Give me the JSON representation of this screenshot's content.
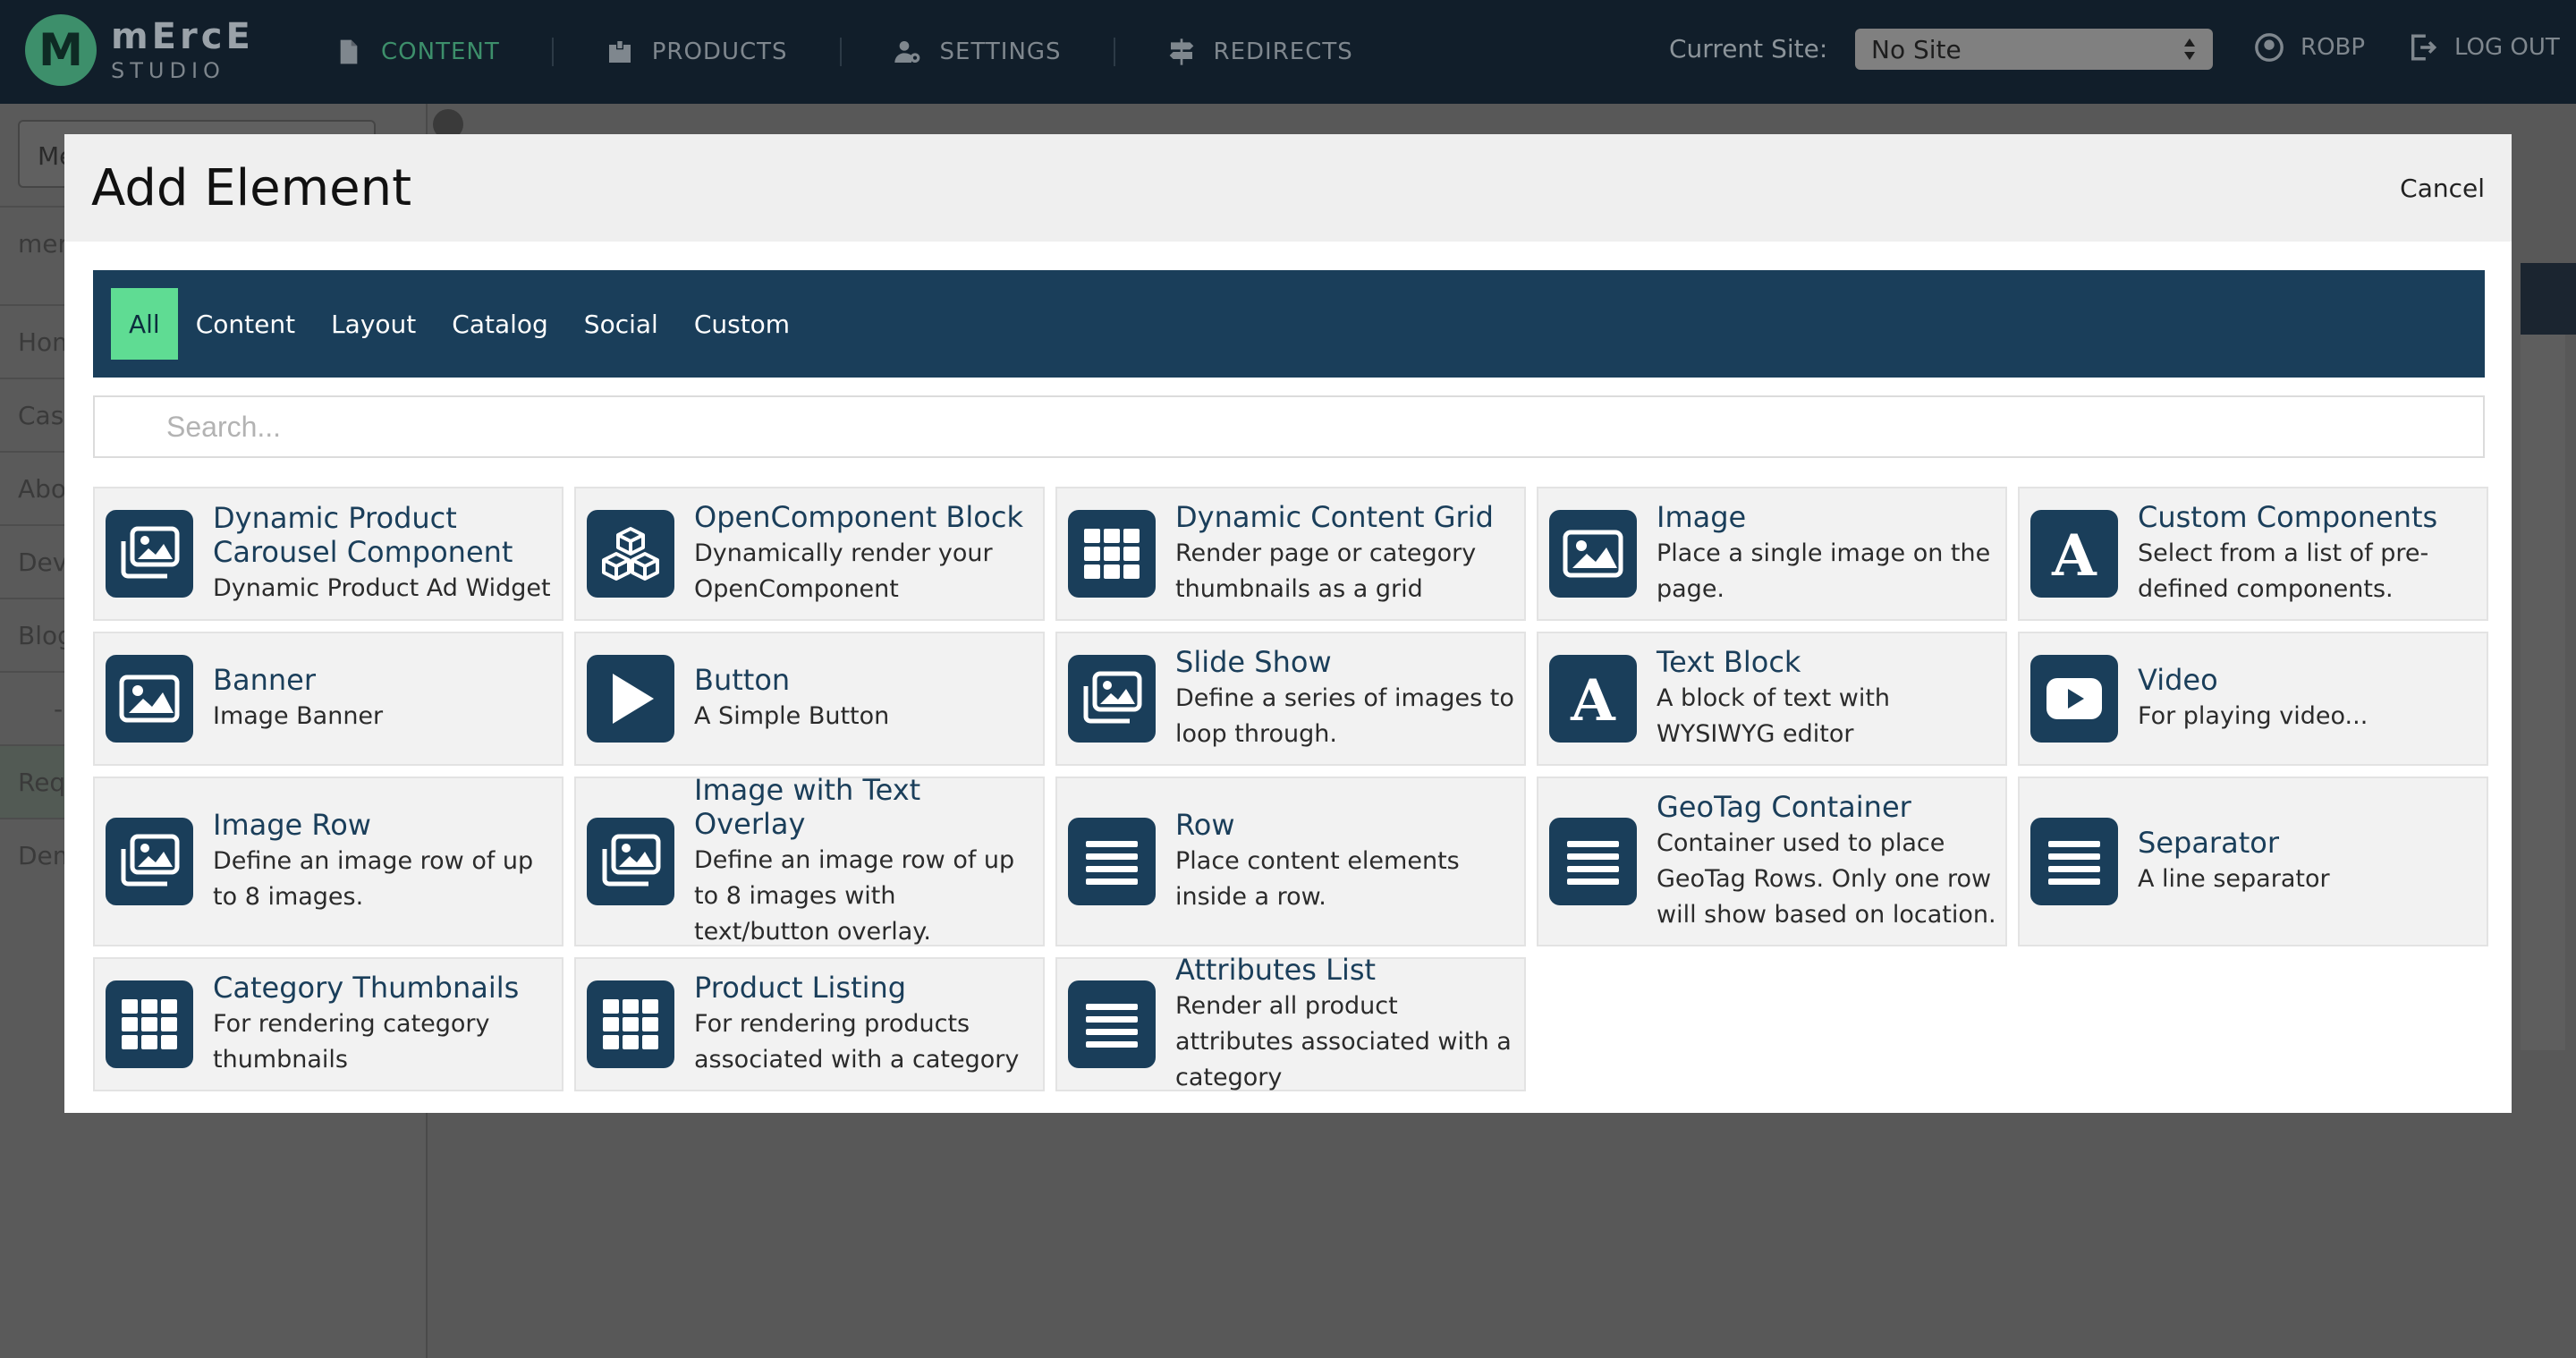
{
  "app": {
    "logo_letter": "M",
    "logo_name": "mErcE",
    "logo_sub": "STUDIO"
  },
  "nav": {
    "items": [
      {
        "label": "CONTENT",
        "icon": "document-icon",
        "active": true
      },
      {
        "label": "PRODUCTS",
        "icon": "products-icon",
        "active": false
      },
      {
        "label": "SETTINGS",
        "icon": "user-settings-icon",
        "active": false
      },
      {
        "label": "REDIRECTS",
        "icon": "signpost-icon",
        "active": false
      }
    ],
    "current_site_label": "Current Site:",
    "current_site_value": "No Site",
    "user_label": "ROBP",
    "logout_label": "LOG OUT"
  },
  "sidebar": {
    "select_value": "Me",
    "items": [
      "mer Com",
      "Hom",
      "Cas",
      "Abo",
      "Dev",
      "Blog",
      "-",
      "Req",
      "Dem"
    ]
  },
  "modal": {
    "title": "Add Element",
    "cancel_label": "Cancel",
    "tabs": [
      "All",
      "Content",
      "Layout",
      "Catalog",
      "Social",
      "Custom"
    ],
    "active_tab": "All",
    "search_placeholder": "Search...",
    "elements": [
      {
        "name": "Dynamic Product Carousel Component",
        "desc": "Dynamic Product Ad Widget",
        "icon": "images-icon"
      },
      {
        "name": "OpenComponent Block",
        "desc": "Dynamically render your OpenComponent",
        "icon": "cubes-icon"
      },
      {
        "name": "Dynamic Content Grid",
        "desc": "Render page or category thumbnails as a grid",
        "icon": "grid-icon"
      },
      {
        "name": "Image",
        "desc": "Place a single image on the page.",
        "icon": "image-icon"
      },
      {
        "name": "Custom Components",
        "desc": "Select from a list of pre-defined components.",
        "icon": "letter-a-icon"
      },
      {
        "name": "Banner",
        "desc": "Image Banner",
        "icon": "image-icon"
      },
      {
        "name": "Button",
        "desc": "A Simple Button",
        "icon": "play-icon"
      },
      {
        "name": "Slide Show",
        "desc": "Define a series of images to loop through.",
        "icon": "images-icon"
      },
      {
        "name": "Text Block",
        "desc": "A block of text with WYSIWYG editor",
        "icon": "letter-a-icon"
      },
      {
        "name": "Video",
        "desc": "For playing video...",
        "icon": "video-icon"
      },
      {
        "name": "Image Row",
        "desc": "Define an image row of up to 8 images.",
        "icon": "images-icon"
      },
      {
        "name": "Image with Text Overlay",
        "desc": "Define an image row of up to 8 images with text/button overlay.",
        "icon": "images-icon"
      },
      {
        "name": "Row",
        "desc": "Place content elements inside a row.",
        "icon": "lines-icon"
      },
      {
        "name": "GeoTag Container",
        "desc": "Container used to place GeoTag Rows. Only one row will show based on location.",
        "icon": "lines-icon"
      },
      {
        "name": "Separator",
        "desc": "A line separator",
        "icon": "lines-icon"
      },
      {
        "name": "Category Thumbnails",
        "desc": "For rendering category thumbnails",
        "icon": "grid-icon"
      },
      {
        "name": "Product Listing",
        "desc": "For rendering products associated with a category",
        "icon": "grid-icon"
      },
      {
        "name": "Attributes List",
        "desc": "Render all product attributes associated with a category",
        "icon": "lines-icon"
      }
    ]
  },
  "colors": {
    "topbar": "#111e2a",
    "accent": "#5fdc93",
    "primary": "#1a3e5a",
    "overlay": "#585858"
  }
}
